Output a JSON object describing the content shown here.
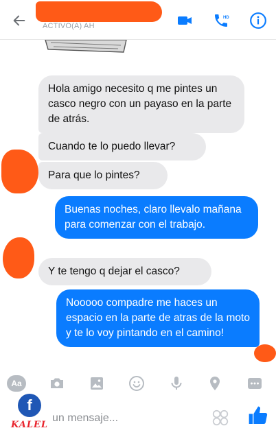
{
  "header": {
    "status": "ACTIVO(A) AH",
    "colors": {
      "accent": "#0a7cff",
      "redaction": "#ff5a17"
    },
    "icons": [
      "back-arrow-icon",
      "video-camera-icon",
      "phone-icon",
      "info-icon"
    ]
  },
  "messages": [
    {
      "from": "them",
      "text": "Hola amigo necesito q me pintes un casco negro con un payaso en la parte de atrás."
    },
    {
      "from": "them",
      "text": "Cuando te lo puedo llevar?"
    },
    {
      "from": "them",
      "text": "Para que lo pintes?"
    },
    {
      "from": "me",
      "text": "Buenas noches, claro llevalo mañana para comenzar con el trabajo."
    },
    {
      "from": "them",
      "text": "Y te tengo q dejar el casco?"
    },
    {
      "from": "me",
      "text": "Nooooo compadre me haces un espacio en la parte de atras de la moto y te lo voy pintando en el camino!"
    }
  ],
  "composer": {
    "aa_label": "Aa",
    "placeholder": "un mensaje...",
    "icons": [
      "camera-icon",
      "gallery-icon",
      "emoji-icon",
      "microphone-icon",
      "location-icon",
      "more-icon",
      "sticker-icon",
      "like-icon"
    ]
  },
  "watermark": {
    "letter": "f",
    "text": "KALEL"
  }
}
